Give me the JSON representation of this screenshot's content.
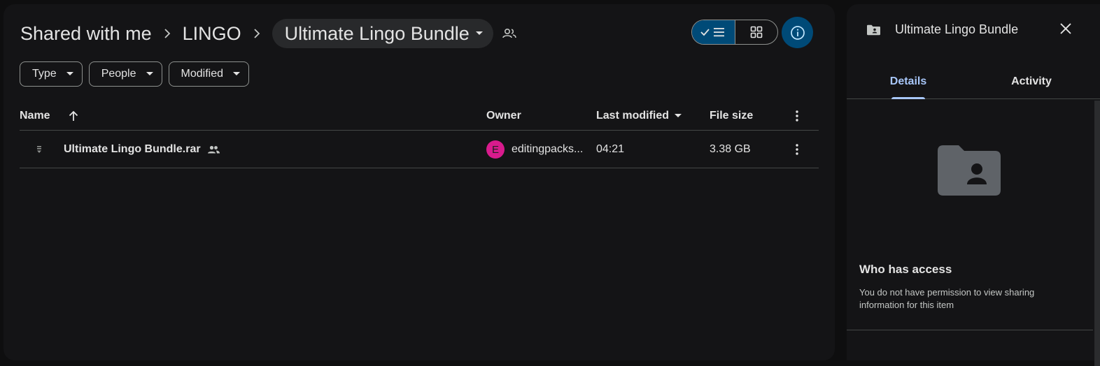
{
  "breadcrumb": {
    "items": [
      "Shared with me",
      "LINGO"
    ],
    "current": "Ultimate Lingo Bundle"
  },
  "filters": [
    "Type",
    "People",
    "Modified"
  ],
  "table": {
    "headers": {
      "name": "Name",
      "owner": "Owner",
      "modified": "Last modified",
      "size": "File size"
    },
    "rows": [
      {
        "name": "Ultimate Lingo Bundle.rar",
        "owner_initial": "E",
        "owner": "editingpacks...",
        "modified": "04:21",
        "size": "3.38 GB"
      }
    ]
  },
  "details_panel": {
    "title": "Ultimate Lingo Bundle",
    "tabs": [
      "Details",
      "Activity"
    ],
    "access_heading": "Who has access",
    "access_text": "You do not have permission to view sharing information for this item"
  },
  "colors": {
    "accent": "#004a77",
    "tab_active": "#a8c7fa",
    "avatar": "#d81b8d"
  }
}
